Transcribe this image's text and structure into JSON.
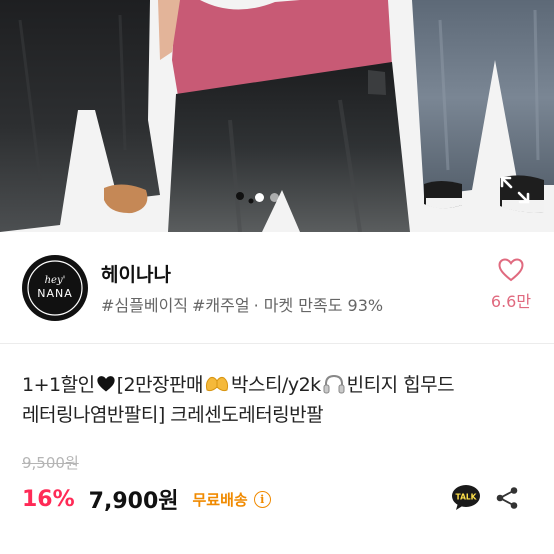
{
  "gallery": {
    "page_count": 2,
    "current_page": 1,
    "expand_icon": "expand-icon"
  },
  "shop": {
    "name": "헤이나나",
    "logo_text": "hey' NANA",
    "tags": [
      "#심플베이직",
      "#캐주얼"
    ],
    "satisfaction": "· 마켓 만족도 93%",
    "like_count": "6.6만",
    "like_icon": "heart-icon",
    "brand_color": "#e06a7f"
  },
  "product": {
    "title_part1": "1+1할인",
    "title_part2": "[2만장판매",
    "title_part3": "박스티/y2k",
    "title_part4": "빈티지 힙무드",
    "title_line2": "레터링나염반팔티] 크레센도레터링반팔",
    "original_price": "9,500원",
    "discount": "16%",
    "price": "7,900원",
    "shipping": "무료배송",
    "discount_color": "#ff2a56",
    "shipping_color": "#f08a00"
  },
  "actions": {
    "talk_label": "TALK",
    "share_icon": "share-icon"
  }
}
